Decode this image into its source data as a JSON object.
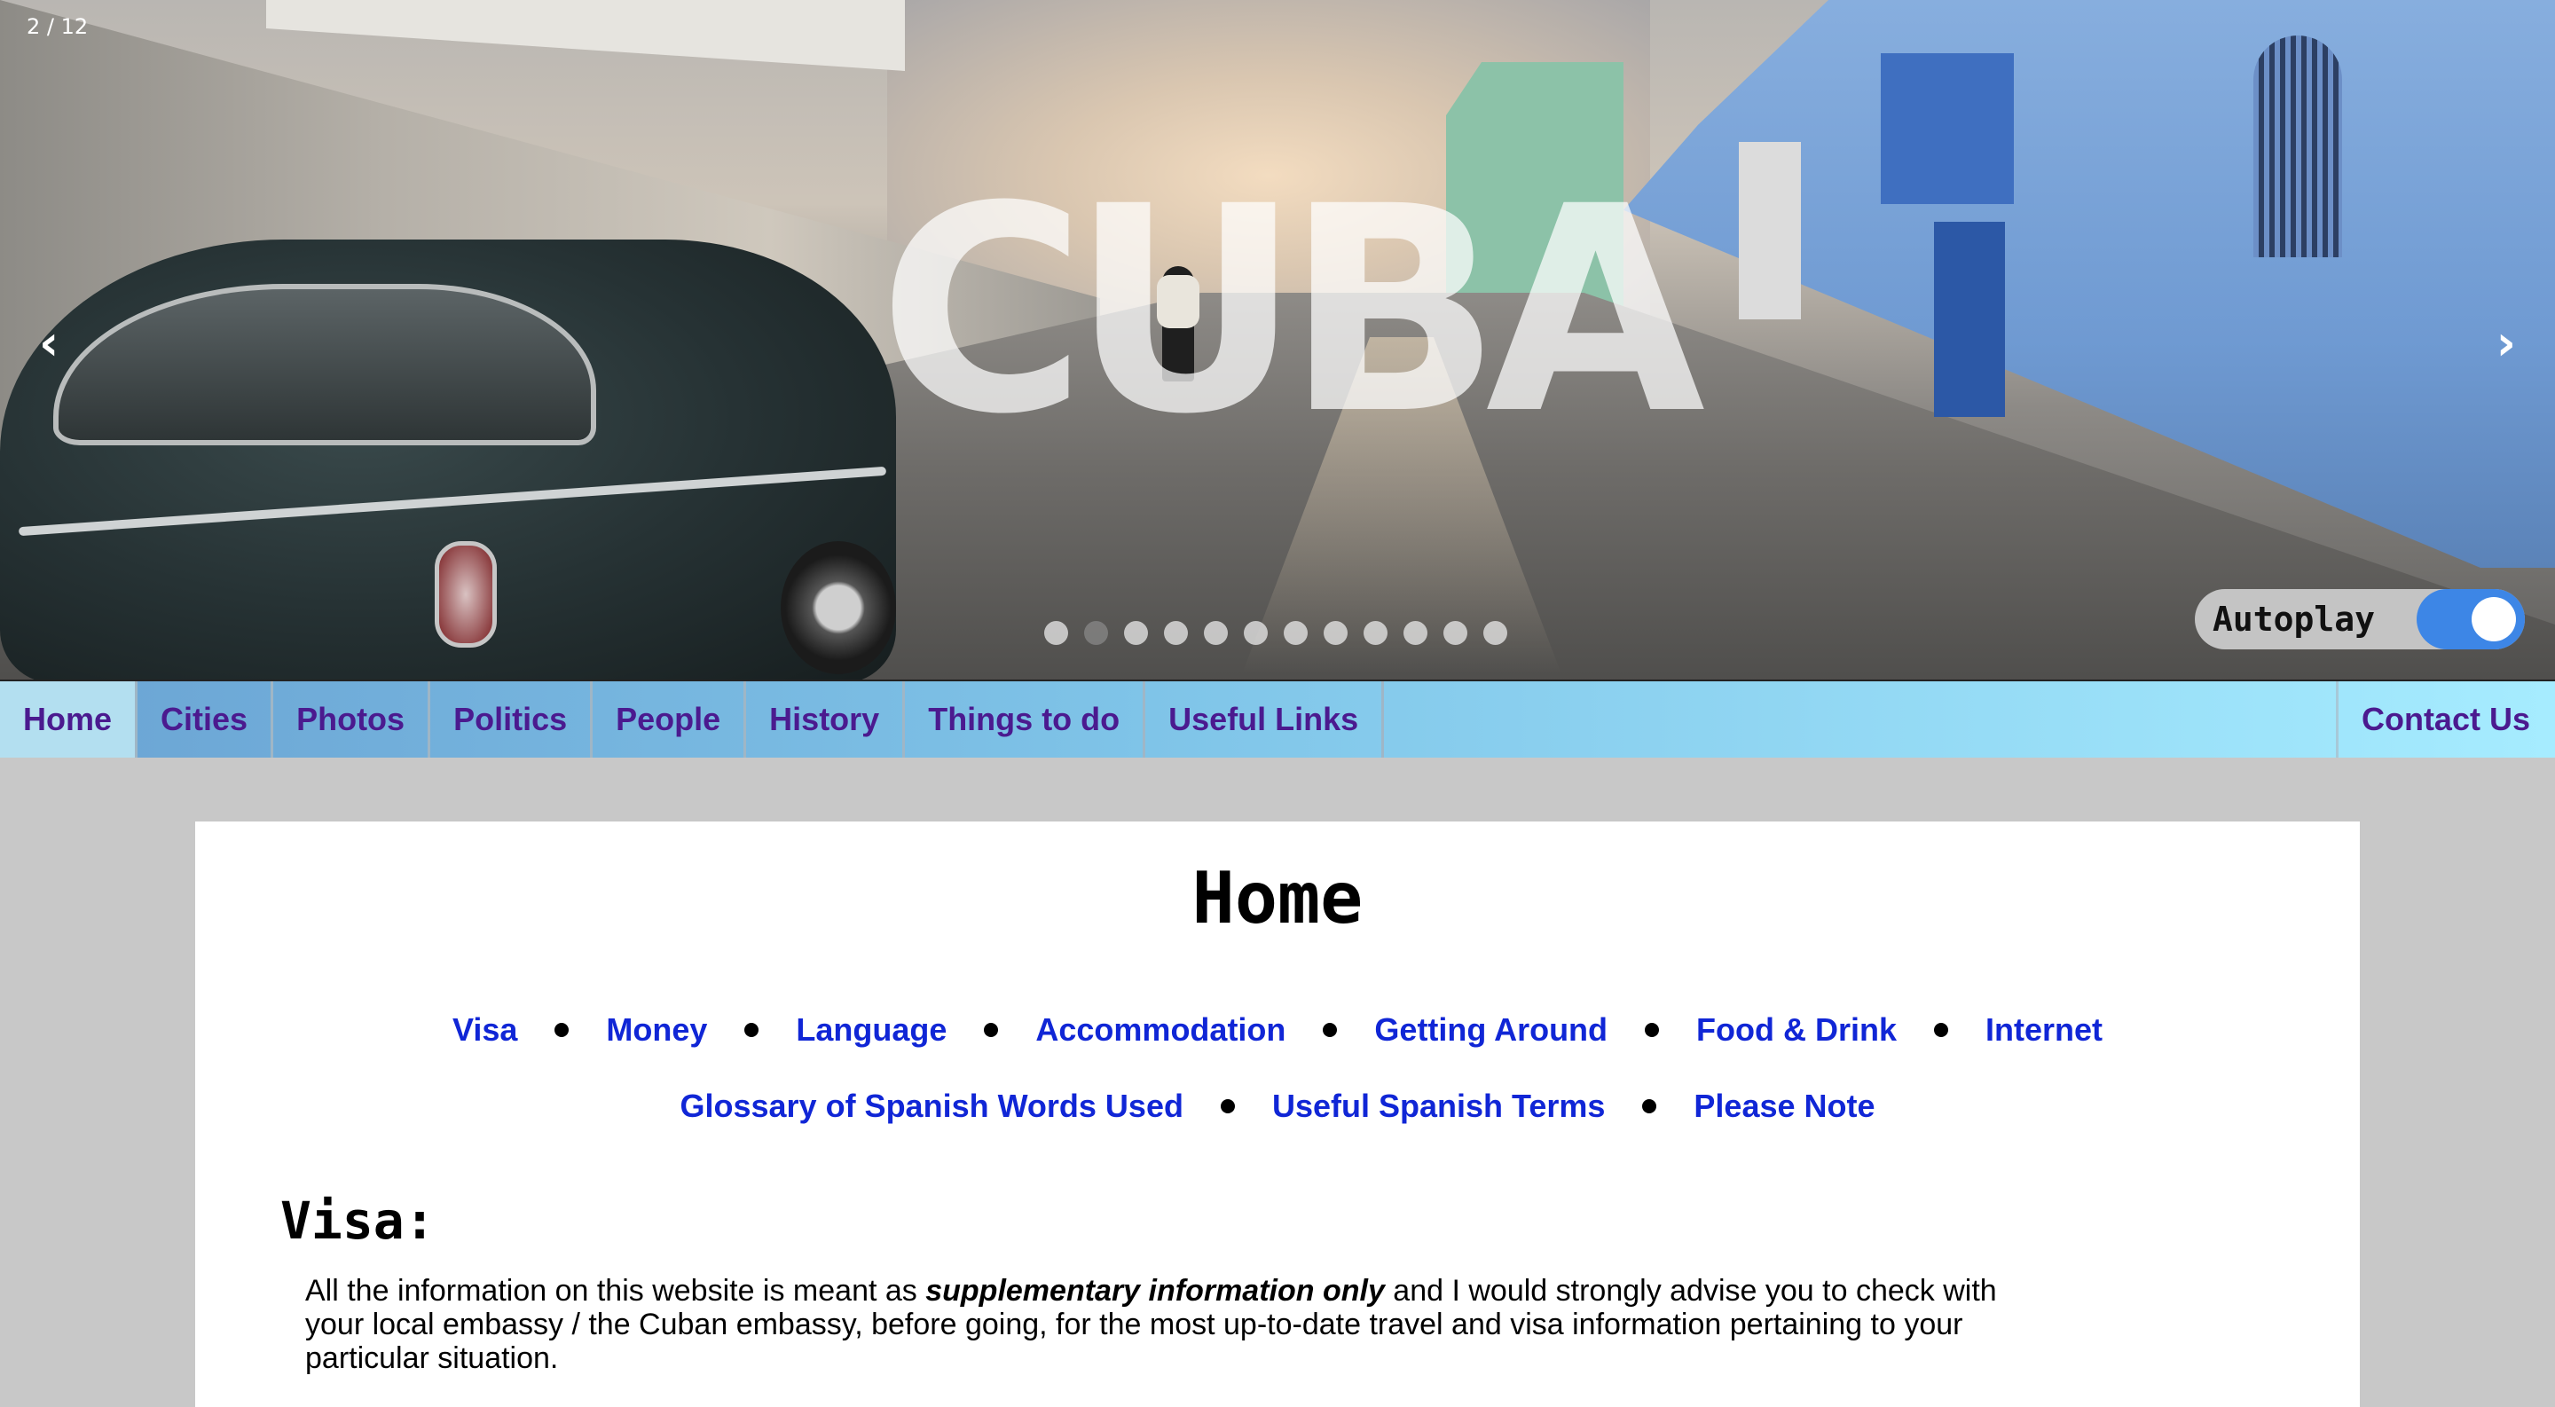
{
  "slideshow": {
    "counter": "2 / 12",
    "title_overlay": "CUBA",
    "prev_arrow": "‹",
    "next_arrow": "›",
    "total_slides": 12,
    "active_slide": 2,
    "autoplay_label": "Autoplay",
    "autoplay_on": true,
    "toggle_color": "#3d86e6"
  },
  "nav": {
    "items": [
      {
        "label": "Home",
        "active": true
      },
      {
        "label": "Cities"
      },
      {
        "label": "Photos"
      },
      {
        "label": "Politics"
      },
      {
        "label": "People"
      },
      {
        "label": "History"
      },
      {
        "label": "Things to do"
      },
      {
        "label": "Useful Links"
      }
    ],
    "contact": "Contact Us",
    "text_color": "#4b1a8f"
  },
  "content": {
    "page_title": "Home",
    "links_row1": [
      "Visa",
      "Money",
      "Language",
      "Accommodation",
      "Getting Around",
      "Food & Drink",
      "Internet"
    ],
    "links_row2": [
      "Glossary of Spanish Words Used",
      "Useful Spanish Terms",
      "Please Note"
    ],
    "link_color": "#1026d6",
    "section_heading": "Visa:",
    "paragraph": {
      "before": "All the information on this website is meant as ",
      "emphasis": "supplementary information only",
      "after": " and I would strongly advise you to check with your local embassy / the Cuban embassy, before going, for the most up-to-date travel and visa information pertaining to your particular situation."
    }
  }
}
